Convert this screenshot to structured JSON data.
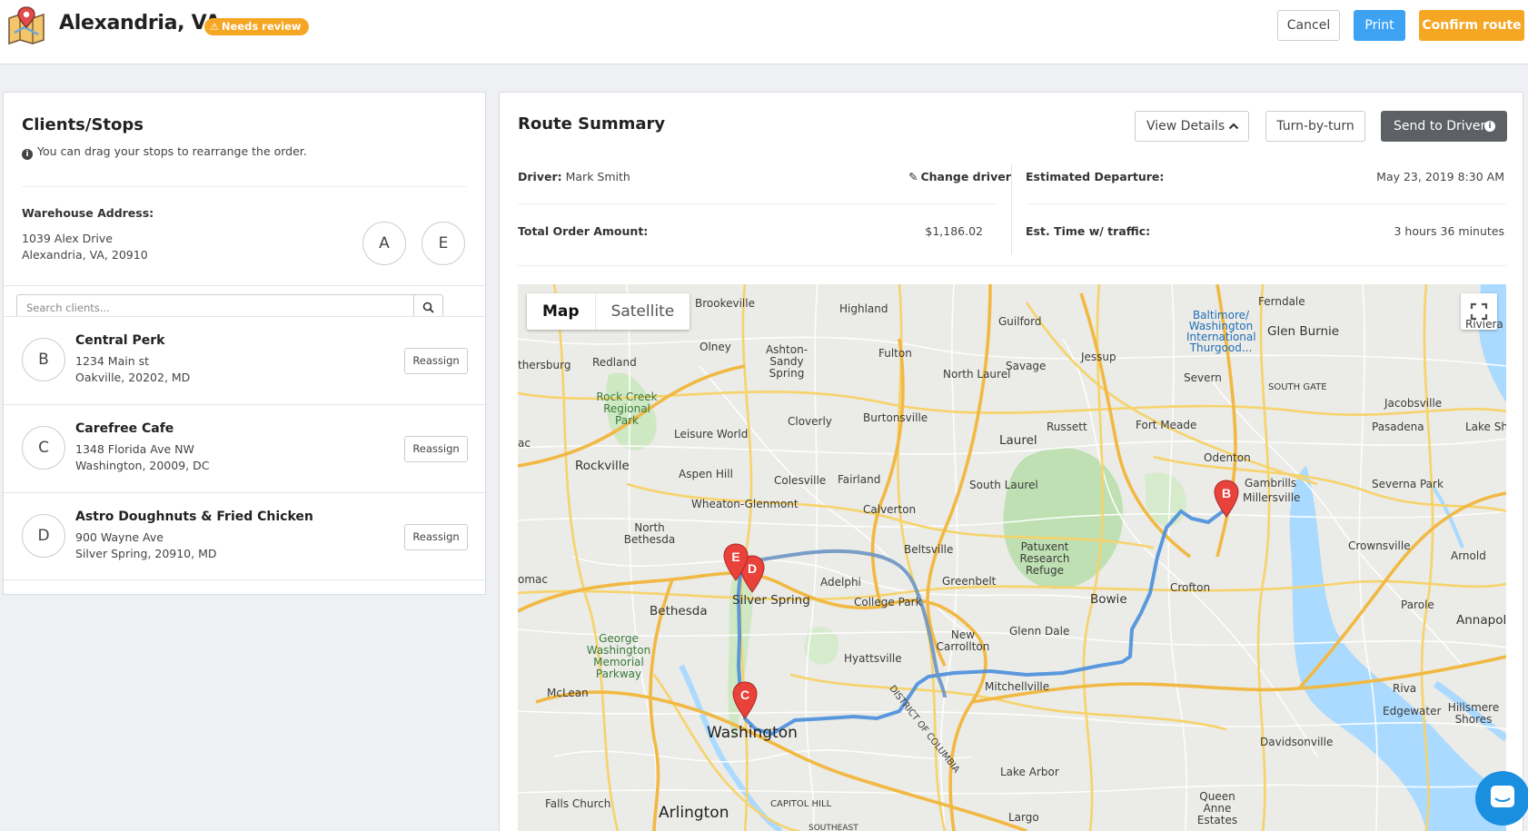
{
  "header": {
    "city": "Alexandria, VA",
    "badge": "Needs review",
    "cancel": "Cancel",
    "print": "Print",
    "confirm": "Confirm route"
  },
  "clients_panel": {
    "title": "Clients/Stops",
    "hint": "You can drag your stops to rearrange the order.",
    "warehouse_label": "Warehouse Address:",
    "warehouse_line1": "1039 Alex Drive",
    "warehouse_line2": "Alexandria, VA, 20910",
    "start_letter": "A",
    "end_letter": "E",
    "search_placeholder": "Search clients...",
    "reassign_label": "Reassign",
    "clients": [
      {
        "letter": "B",
        "name": "Central Perk",
        "addr1": "1234 Main st",
        "addr2": "Oakville, 20202, MD"
      },
      {
        "letter": "C",
        "name": "Carefree Cafe",
        "addr1": "1348 Florida Ave NW",
        "addr2": "Washington, 20009, DC"
      },
      {
        "letter": "D",
        "name": "Astro Doughnuts & Fried Chicken",
        "addr1": "900 Wayne Ave",
        "addr2": "Silver Spring, 20910, MD"
      }
    ]
  },
  "summary": {
    "title": "Route Summary",
    "view_details": "View Details",
    "turn_by_turn": "Turn-by-turn",
    "send_to_driver": "Send to Driver",
    "driver_label": "Driver:",
    "driver_name": "Mark Smith",
    "change_driver": "Change driver",
    "total_label": "Total Order Amount:",
    "total_value": "$1,186.02",
    "departure_label": "Estimated Departure:",
    "departure_value": "May 23, 2019 8:30 AM",
    "traffic_label": "Est. Time w/ traffic:",
    "traffic_value": "3 hours 36 minutes"
  },
  "map": {
    "map_tab": "Map",
    "satellite_tab": "Satellite",
    "pins": [
      "B",
      "C",
      "D",
      "E"
    ],
    "places": {
      "washington": "Washington",
      "silver_spring": "Silver Spring",
      "bethesda": "Bethesda",
      "arlington": "Arlington",
      "rockville": "Rockville",
      "laurel": "Laurel",
      "bowie": "Bowie",
      "annapolis": "Annapolis",
      "baltimore": "Baltimore/ Washington International Thurgood...",
      "glen_burnie": "Glen Burnie",
      "crofton": "Crofton",
      "odenton": "Odenton",
      "college_park": "College Park",
      "hyattsville": "Hyattsville",
      "greenbelt": "Greenbelt",
      "mclean": "McLean",
      "olney": "Olney",
      "columbia_dist": "DISTRICT OF COLUMBIA",
      "patuxent": "Patuxent Research Refuge",
      "rock_creek": "Rock Creek Regional Park",
      "gw_parkway": "George Washington Memorial Parkway",
      "fort_meade": "Fort Meade",
      "severna_park": "Severna Park",
      "millersville": "Millersville",
      "gambrills": "Gambrills",
      "crownsville": "Crownsville",
      "parole": "Parole",
      "mitchellville": "Mitchellville",
      "new_carrollton": "New Carrollton",
      "glenn_dale": "Glenn Dale",
      "largo": "Largo",
      "lake_arbor": "Lake Arbor",
      "queen_anne": "Queen Anne Estates",
      "davidsonville": "Davidsonville",
      "edgewater": "Edgewater",
      "riva": "Riva",
      "hillsmere": "Hillsmere Shores",
      "arnold": "Arnold",
      "pasadena": "Pasadena",
      "severn": "Severn",
      "jessup": "Jessup",
      "savage": "Savage",
      "north_laurel": "North Laurel",
      "south_laurel": "South Laurel",
      "russett": "Russett",
      "fulton": "Fulton",
      "highland": "Highland",
      "guilford": "Guilford",
      "ferndale": "Ferndale",
      "jacobsville": "Jacobsville",
      "south_gate": "SOUTH GATE",
      "brookeville": "Brookeville",
      "ashton": "Ashton-Sandy Spring",
      "redland": "Redland",
      "leisure_world": "Leisure World",
      "cloverly": "Cloverly",
      "burtonsville": "Burtonsville",
      "aspen_hill": "Aspen Hill",
      "colesville": "Colesville",
      "fairland": "Fairland",
      "calverton": "Calverton",
      "wheaton": "Wheaton-Glenmont",
      "north_bethesda": "North Bethesda",
      "beltsville": "Beltsville",
      "adelphi": "Adelphi",
      "falls_church": "Falls Church",
      "capitol_hill": "CAPITOL HILL",
      "gaithersburg": "thersburg",
      "potomac": "omac",
      "ac": "ac",
      "riviera": "Riviera E",
      "lake_shore": "Lake Shor",
      "southeast": "SOUTHEAST"
    }
  }
}
